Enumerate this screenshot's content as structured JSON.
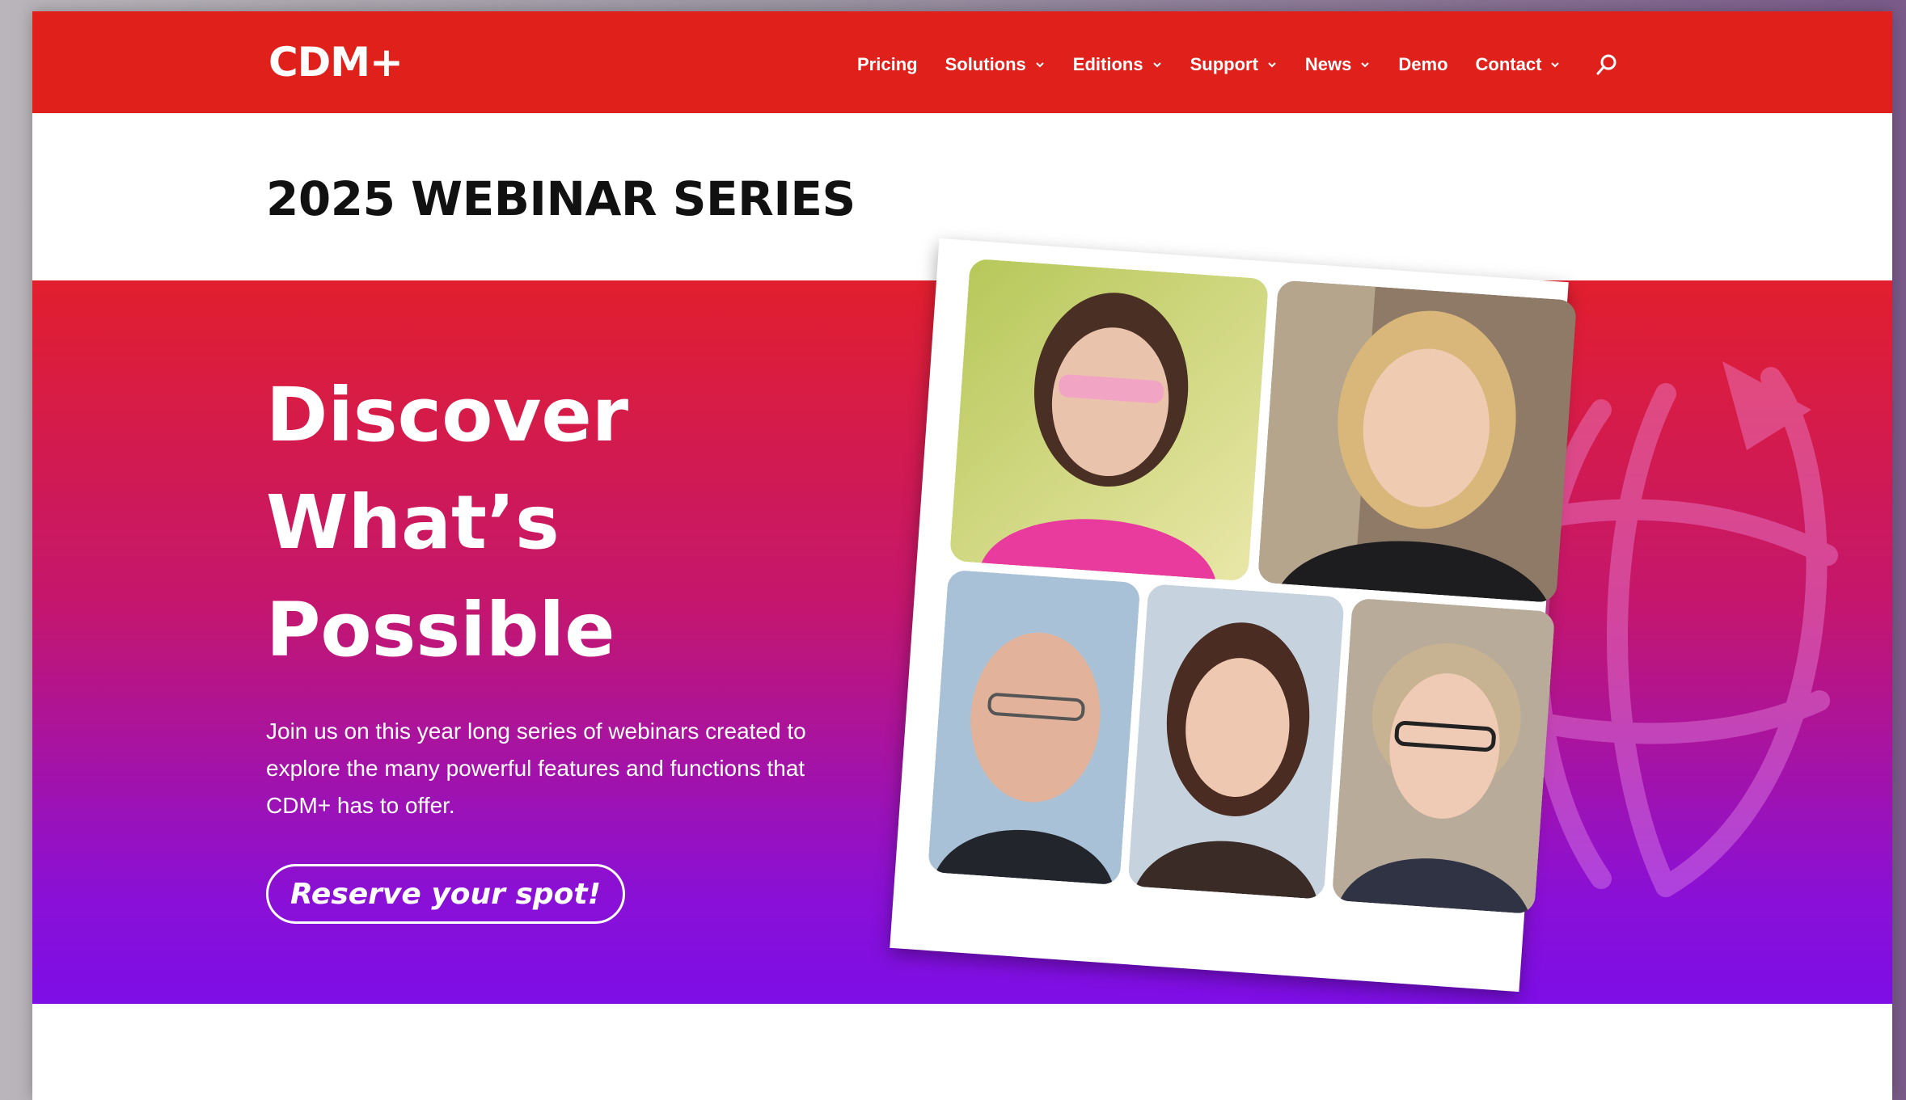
{
  "brand": {
    "logo_text": "CDM+",
    "nav_color": "#e0201a",
    "hero_gradient_top": "#e21f2e",
    "hero_gradient_bottom": "#7d0ee6"
  },
  "nav": {
    "items": [
      {
        "label": "Pricing",
        "has_dropdown": false
      },
      {
        "label": "Solutions",
        "has_dropdown": true
      },
      {
        "label": "Editions",
        "has_dropdown": true
      },
      {
        "label": "Support",
        "has_dropdown": true
      },
      {
        "label": "News",
        "has_dropdown": true
      },
      {
        "label": "Demo",
        "has_dropdown": false
      },
      {
        "label": "Contact",
        "has_dropdown": true
      }
    ],
    "search_icon": "search-icon"
  },
  "header": {
    "series_title": "2025 WEBINAR SERIES"
  },
  "hero": {
    "heading_lines": [
      "Discover",
      "What’s",
      "Possible"
    ],
    "body": "Join us on this year long series of webinars created to explore the many powerful features and functions that CDM+ has to offer.",
    "cta_label": "Reserve your spot!"
  },
  "photos": [
    {
      "name": "presenter-photo-1"
    },
    {
      "name": "presenter-photo-2"
    },
    {
      "name": "presenter-photo-3"
    },
    {
      "name": "presenter-photo-4"
    },
    {
      "name": "presenter-photo-5"
    }
  ]
}
